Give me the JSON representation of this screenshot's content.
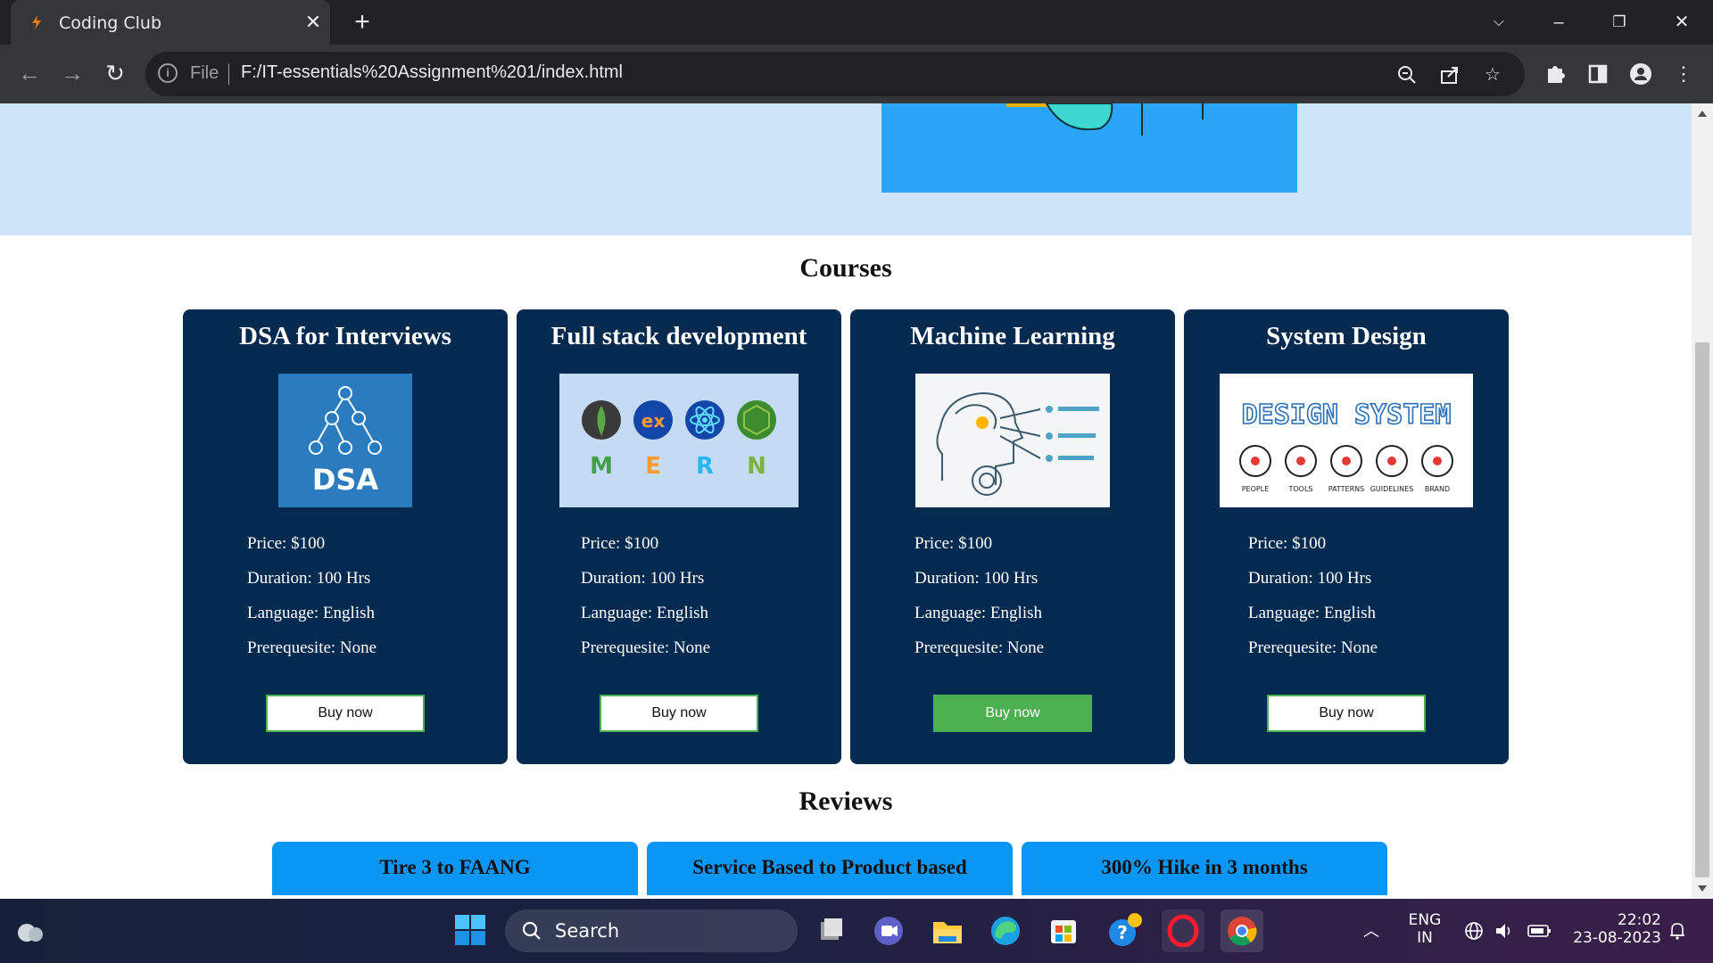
{
  "browser": {
    "tab_title": "Coding Club",
    "close_tab": "✕",
    "new_tab": "+",
    "omnibox_scheme": "File",
    "url": "F:/IT-essentials%20Assignment%201/index.html"
  },
  "courses_heading": "Courses",
  "courses": [
    {
      "title": "DSA for Interviews",
      "price": "Price: $100",
      "duration": "Duration: 100 Hrs",
      "language": "Language: English",
      "prereq": "Prerequesite: None",
      "button": "Buy now",
      "image_text": "DSA"
    },
    {
      "title": "Full stack development",
      "price": "Price: $100",
      "duration": "Duration: 100 Hrs",
      "language": "Language: English",
      "prereq": "Prerequesite: None",
      "button": "Buy now",
      "image_letters": [
        "M",
        "E",
        "R",
        "N"
      ],
      "image_badge": "ex"
    },
    {
      "title": "Machine Learning",
      "price": "Price: $100",
      "duration": "Duration: 100 Hrs",
      "language": "Language: English",
      "prereq": "Prerequesite: None",
      "button": "Buy now"
    },
    {
      "title": "System Design",
      "price": "Price: $100",
      "duration": "Duration: 100 Hrs",
      "language": "Language: English",
      "prereq": "Prerequesite: None",
      "button": "Buy now",
      "image_text": "DESIGN SYSTEM",
      "image_labels": [
        "PEOPLE",
        "TOOLS",
        "PATTERNS",
        "GUIDELINES",
        "BRAND"
      ]
    }
  ],
  "reviews_heading": "Reviews",
  "reviews": [
    "Tire 3 to FAANG",
    "Service Based to Product based",
    "300% Hike in 3 months"
  ],
  "taskbar": {
    "search_label": "Search",
    "lang_1": "ENG",
    "lang_2": "IN",
    "time": "22:02",
    "date": "23-08-2023"
  },
  "colors": {
    "card_bg": "#052a4f",
    "hero_bg": "#cce5f9",
    "review_bg": "#0a96f5",
    "button_hover": "#4caf50"
  }
}
